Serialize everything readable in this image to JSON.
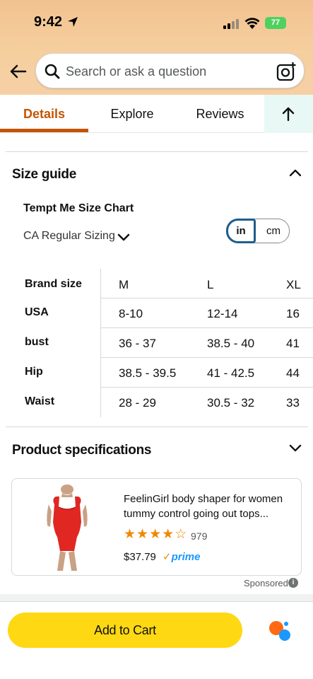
{
  "status_bar": {
    "time": "9:42",
    "battery": "77"
  },
  "search": {
    "placeholder": "Search or ask a question"
  },
  "tabs": [
    {
      "label": "Details",
      "active": true
    },
    {
      "label": "Explore",
      "active": false
    },
    {
      "label": "Reviews",
      "active": false
    }
  ],
  "size_guide": {
    "title": "Size guide",
    "chart_title": "Tempt Me Size Chart",
    "sizing_selector": "CA Regular Sizing",
    "units": {
      "in": "in",
      "cm": "cm",
      "selected": "in"
    },
    "table": {
      "header_label": "Brand size",
      "columns": [
        "M",
        "L",
        "XL"
      ],
      "rows": [
        {
          "label": "USA",
          "values": [
            "8-10",
            "12-14",
            "16"
          ]
        },
        {
          "label": "bust",
          "values": [
            "36 - 37",
            "38.5 - 40",
            "41"
          ]
        },
        {
          "label": "Hip",
          "values": [
            "38.5 - 39.5",
            "41 - 42.5",
            "44"
          ]
        },
        {
          "label": "Waist",
          "values": [
            "28 - 29",
            "30.5 - 32",
            "33"
          ]
        }
      ]
    }
  },
  "product_specs": {
    "title": "Product specifications"
  },
  "ad": {
    "title": "FeelinGirl body shaper for women tummy control going out tops...",
    "rating_stars": 4,
    "rating_count": "979",
    "price": "$37.79",
    "prime_label": "prime",
    "sponsored_label": "Sponsored"
  },
  "cart": {
    "button_label": "Add to Cart"
  },
  "colors": {
    "accent": "#c45500",
    "cart_button": "#ffd814",
    "header_bg": "#f2c290"
  }
}
